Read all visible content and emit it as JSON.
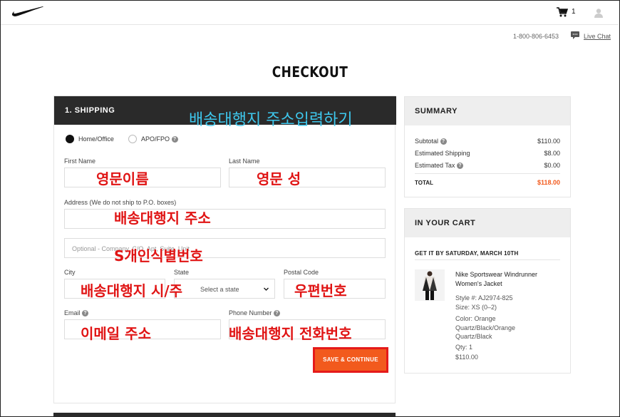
{
  "header": {
    "cart_count": "1",
    "phone": "1-800-806-6453",
    "live_chat": "Live Chat"
  },
  "page_title": "CHECKOUT",
  "shipping": {
    "heading": "1. SHIPPING",
    "annotation": "배송대행지 주소입력하기",
    "options": [
      {
        "label": "Home/Office",
        "selected": true
      },
      {
        "label": "APO/FPO",
        "selected": false
      }
    ],
    "first_name_label": "First Name",
    "first_name_note": "영문이름",
    "last_name_label": "Last Name",
    "last_name_note": "영문 성",
    "address_label": "Address (We do not ship to P.O. boxes)",
    "address_note": "배송대행지 주소",
    "optional_placeholder": "Optional - Company, C/O, Apt, Suite, Unit",
    "optional_note": "S개인식별번호",
    "city_label": "City",
    "state_label": "State",
    "state_value": "Select a state",
    "city_state_note": "배송대행지 시/주",
    "postal_label": "Postal Code",
    "postal_note": "우편번호",
    "email_label": "Email",
    "email_note": "이메일 주소",
    "phone_label": "Phone Number",
    "phone_note": "배송대행지 전화번호",
    "submit_label": "SAVE & CONTINUE"
  },
  "summary": {
    "heading": "SUMMARY",
    "rows": [
      {
        "label": "Subtotal",
        "value": "$110.00"
      },
      {
        "label": "Estimated Shipping",
        "value": "$8.00"
      },
      {
        "label": "Estimated Tax",
        "value": "$0.00"
      }
    ],
    "total_label": "TOTAL",
    "total_value": "$118.00"
  },
  "cart": {
    "heading": "IN YOUR CART",
    "delivery": "GET IT BY SATURDAY, MARCH 10TH",
    "item": {
      "name_line1": "Nike Sportswear Windrunner",
      "name_line2": "Women's Jacket",
      "style": "Style #: AJ2974-825",
      "size": "Size: XS (0–2)",
      "color_line1": "Color: Orange",
      "color_line2": "Quartz/Black/Orange",
      "color_line3": "Quartz/Black",
      "qty": "Qty: 1",
      "price": "$110.00"
    }
  },
  "colors": {
    "accent": "#f25a1d",
    "annotation_red": "#e01414",
    "annotation_cyan": "#3ec8ee",
    "header_dark": "#2a2a2a"
  }
}
